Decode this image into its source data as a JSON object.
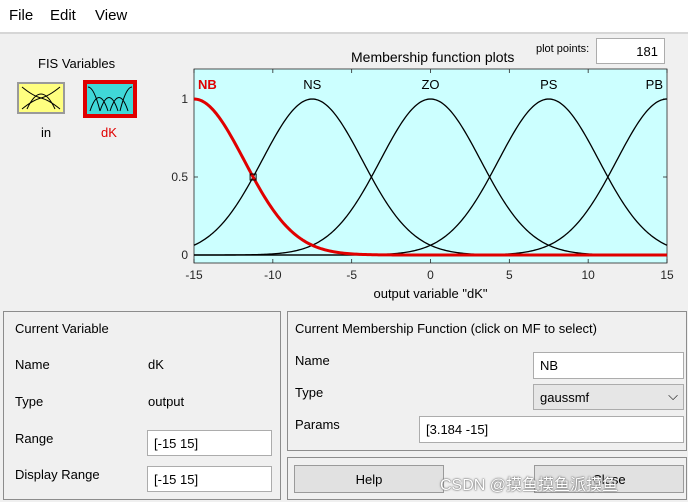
{
  "menu": {
    "file": "File",
    "edit": "Edit",
    "view": "View"
  },
  "fis": {
    "title": "FIS Variables",
    "input_label": "in",
    "output_label": "dK"
  },
  "plot": {
    "title": "Membership function plots",
    "points_label": "plot points:",
    "points_value": "181"
  },
  "chart_data": {
    "type": "line",
    "title": "Membership function plots",
    "xlabel": "output variable \"dK\"",
    "ylabel": "",
    "xlim": [
      -15,
      15
    ],
    "ylim": [
      0,
      1
    ],
    "xticks": [
      -15,
      -10,
      -5,
      0,
      5,
      10,
      15
    ],
    "yticks": [
      0,
      0.5,
      1
    ],
    "grid": false,
    "series": [
      {
        "name": "NB",
        "mf": "gaussmf",
        "sigma": 3.184,
        "center": -15,
        "color": "#e00000",
        "selected": true
      },
      {
        "name": "NS",
        "mf": "gaussmf",
        "sigma": 3.184,
        "center": -7.5,
        "color": "#000000",
        "selected": false
      },
      {
        "name": "ZO",
        "mf": "gaussmf",
        "sigma": 3.184,
        "center": 0,
        "color": "#000000",
        "selected": false
      },
      {
        "name": "PS",
        "mf": "gaussmf",
        "sigma": 3.184,
        "center": 7.5,
        "color": "#000000",
        "selected": false
      },
      {
        "name": "PB",
        "mf": "gaussmf",
        "sigma": 3.184,
        "center": 15,
        "color": "#000000",
        "selected": false
      }
    ]
  },
  "current_variable": {
    "title": "Current Variable",
    "name_label": "Name",
    "name_value": "dK",
    "type_label": "Type",
    "type_value": "output",
    "range_label": "Range",
    "range_value": "[-15 15]",
    "display_range_label": "Display Range",
    "display_range_value": "[-15 15]"
  },
  "current_mf": {
    "title": "Current Membership Function (click on MF to select)",
    "name_label": "Name",
    "name_value": "NB",
    "type_label": "Type",
    "type_value": "gaussmf",
    "params_label": "Params",
    "params_value": "[3.184 -15]"
  },
  "buttons": {
    "help": "Help",
    "close": "Close"
  },
  "watermark": "CSDN @摸鱼摸鱼派摸鱼"
}
